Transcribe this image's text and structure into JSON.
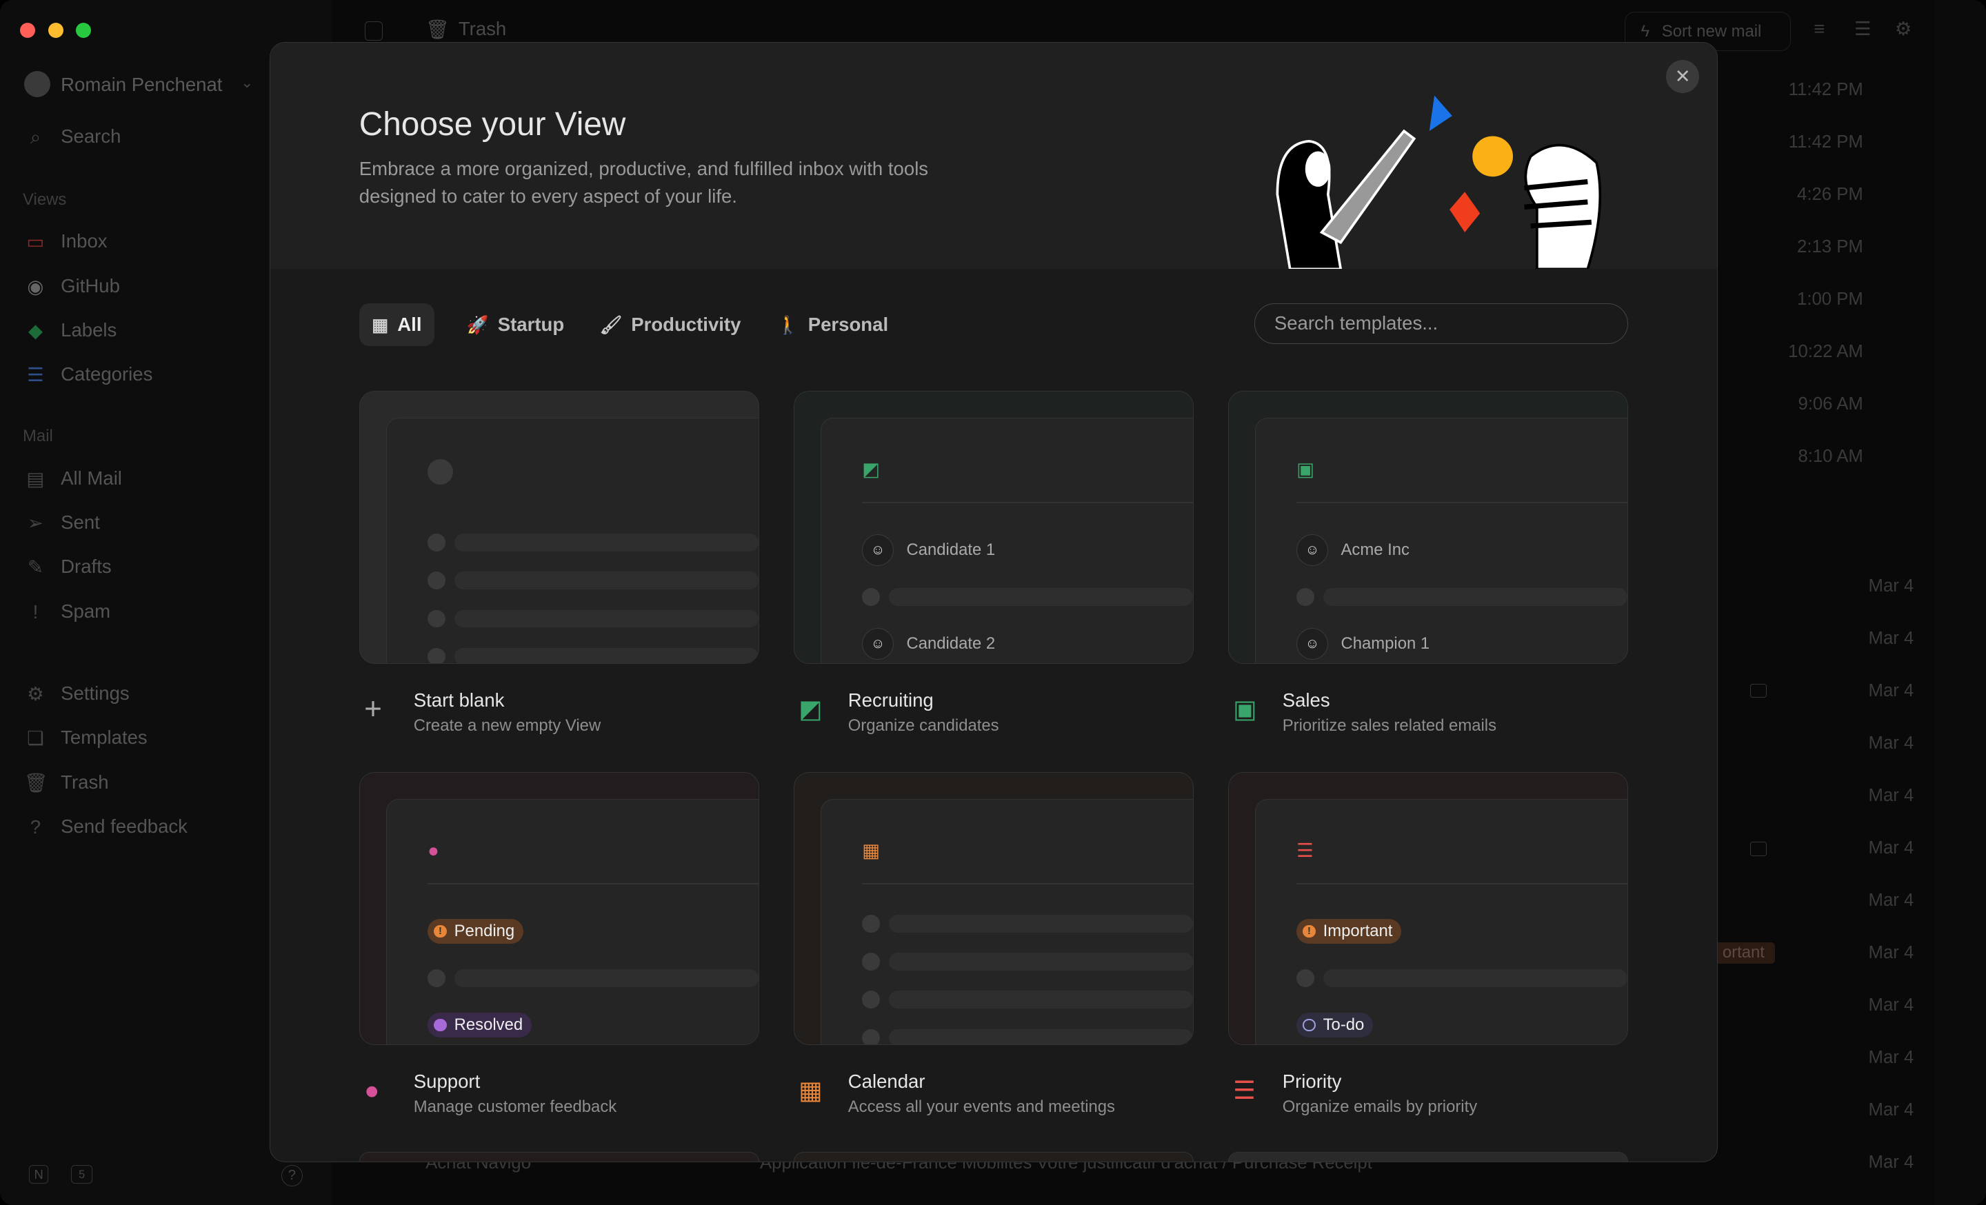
{
  "window": {
    "traffic_colors": [
      "#ff5f57",
      "#febc2e",
      "#28c840"
    ]
  },
  "sidebar": {
    "user": "Romain Penchenat",
    "search": "Search",
    "views_heading": "Views",
    "views": [
      {
        "label": "Inbox",
        "icon": "inbox-icon",
        "color": "#8a2a2a"
      },
      {
        "label": "GitHub",
        "icon": "github-icon",
        "color": "#666"
      },
      {
        "label": "Labels",
        "icon": "tag-icon",
        "color": "#1e6b3a"
      },
      {
        "label": "Categories",
        "icon": "list-icon",
        "color": "#2f4e8a"
      }
    ],
    "mail_heading": "Mail",
    "mail": [
      {
        "label": "All Mail",
        "icon": "archive-icon"
      },
      {
        "label": "Sent",
        "icon": "send-icon"
      },
      {
        "label": "Drafts",
        "icon": "draft-icon"
      },
      {
        "label": "Spam",
        "icon": "spam-icon"
      }
    ],
    "other": [
      {
        "label": "Settings",
        "icon": "gear-icon"
      },
      {
        "label": "Templates",
        "icon": "templates-icon"
      },
      {
        "label": "Trash",
        "icon": "trash-icon"
      },
      {
        "label": "Send feedback",
        "icon": "help-icon"
      }
    ]
  },
  "toolbar": {
    "folder": "Trash",
    "sort": "Sort new mail"
  },
  "mail_times": [
    "11:42 PM",
    "11:42 PM",
    "4:26 PM",
    "2:13 PM",
    "1:00 PM",
    "10:22 AM",
    "9:06 AM",
    "8:10 AM"
  ],
  "mail_dates": [
    "Mar 4",
    "Mar 4",
    "Mar 4",
    "Mar 4",
    "Mar 4",
    "Mar 4",
    "Mar 4",
    "Mar 4",
    "Mar 4",
    "Mar 4",
    "Mar 4",
    "Mar 4"
  ],
  "partial_label": "ortant",
  "bottom_row": {
    "sender": "Achat Navigo",
    "subject": "Application Île-de-France Mobilités Votre justificatif d'achat / Purchase Receipt"
  },
  "modal": {
    "title": "Choose your View",
    "subtitle": "Embrace a more organized, productive, and fulfilled inbox with tools designed to cater to every aspect of your life.",
    "close": "✕",
    "tabs": [
      {
        "label": "All",
        "icon": "grid-icon",
        "active": true
      },
      {
        "label": "Startup",
        "icon": "rocket-icon"
      },
      {
        "label": "Productivity",
        "icon": "brush-icon"
      },
      {
        "label": "Personal",
        "icon": "person-icon"
      }
    ],
    "search_placeholder": "Search templates...",
    "templates": [
      {
        "name": "Start blank",
        "desc": "Create a new empty View",
        "icon": "plus-icon",
        "color": "#aaaaaa",
        "tint": "#2a2a2a",
        "preview": [
          {
            "type": "skeleton"
          },
          {
            "type": "skeleton"
          },
          {
            "type": "skeleton"
          },
          {
            "type": "skeleton"
          }
        ]
      },
      {
        "name": "Recruiting",
        "desc": "Organize candidates",
        "icon": "note-icon",
        "color": "#3aa56a",
        "tint": "#1e2221",
        "preview": [
          {
            "type": "avatar",
            "text": "Candidate 1"
          },
          {
            "type": "skeleton"
          },
          {
            "type": "avatar",
            "text": "Candidate 2"
          }
        ]
      },
      {
        "name": "Sales",
        "desc": "Prioritize sales related emails",
        "icon": "money-icon",
        "color": "#3aa56a",
        "tint": "#1e2221",
        "preview": [
          {
            "type": "avatar",
            "text": "Acme Inc"
          },
          {
            "type": "skeleton"
          },
          {
            "type": "avatar",
            "text": "Champion 1"
          }
        ]
      },
      {
        "name": "Support",
        "desc": "Manage customer feedback",
        "icon": "chat-icon",
        "color": "#d6509a",
        "tint": "#221c1e",
        "preview": [
          {
            "type": "badge",
            "text": "Pending",
            "bg": "#5a3a22",
            "dot": "#e8863a",
            "mark": "!"
          },
          {
            "type": "skeleton"
          },
          {
            "type": "badge",
            "text": "Resolved",
            "bg": "#3a2a4a",
            "dot": "#a86ad8",
            "mark": ""
          }
        ]
      },
      {
        "name": "Calendar",
        "desc": "Access all your events and meetings",
        "icon": "calendar-icon",
        "color": "#e8863a",
        "tint": "#221e1b",
        "preview": [
          {
            "type": "skeleton"
          },
          {
            "type": "skeleton"
          },
          {
            "type": "skeleton"
          },
          {
            "type": "skeleton"
          }
        ]
      },
      {
        "name": "Priority",
        "desc": "Organize emails by priority",
        "icon": "priority-list-icon",
        "color": "#e8504a",
        "tint": "#221c1c",
        "preview": [
          {
            "type": "badge",
            "text": "Important",
            "bg": "#5a3a22",
            "dot": "#e8863a",
            "mark": "!"
          },
          {
            "type": "skeleton"
          },
          {
            "type": "badge",
            "text": "To-do",
            "bg": "#2e2e3e",
            "dot": "transparent",
            "ring": "#a0a0e0",
            "mark": ""
          }
        ]
      }
    ]
  }
}
